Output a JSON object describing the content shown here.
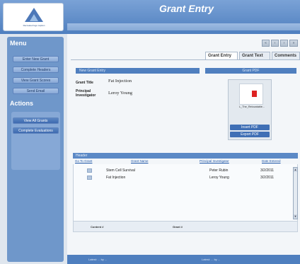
{
  "header": {
    "title": "Grant Entry",
    "logo_text": "Recreated logo caption"
  },
  "sidebar": {
    "menu_title": "Menu",
    "menu_items": [
      "Enter New Grant",
      "Complete Headers",
      "View Grant Scores",
      "Send Email"
    ],
    "actions_title": "Actions",
    "action_items": [
      "View All Grants",
      "Complete Evaluations"
    ]
  },
  "pager": {
    "buttons": [
      "«",
      "‹",
      "›",
      "»"
    ]
  },
  "tabs": [
    "Grant Entry",
    "Grant Text",
    "Comments"
  ],
  "form": {
    "section_title": "New Grant Entry",
    "grant_title_label": "Grant Title",
    "grant_title_value": "Fat Injection",
    "pi_label": "Principal Investigator",
    "pi_value": "Leroy Young"
  },
  "pdf": {
    "section_title": "Grant PDF",
    "file_name": "L_The_Relocatable...",
    "insert_label": "Insert PDF",
    "export_label": "Export PDF"
  },
  "grid": {
    "title": "Header",
    "columns": [
      "Go To Grant",
      "Grant Name",
      "Principal Investigator",
      "Date Entered"
    ],
    "rows": [
      {
        "name": "Stem Cell Survival",
        "pi": "Peter Rubin",
        "date": "3/2/2011"
      },
      {
        "name": "Fat Injection",
        "pi": "Leroy Young",
        "date": "3/2/2011"
      }
    ],
    "footer_left": "Content #",
    "footer_right": "Grant #"
  },
  "footer": {
    "left": "Latest: ... by ...",
    "right": "Latest: ... by ..."
  },
  "colors": {
    "brand": "#4f7fbf",
    "sidebar": "#6f97ca"
  }
}
